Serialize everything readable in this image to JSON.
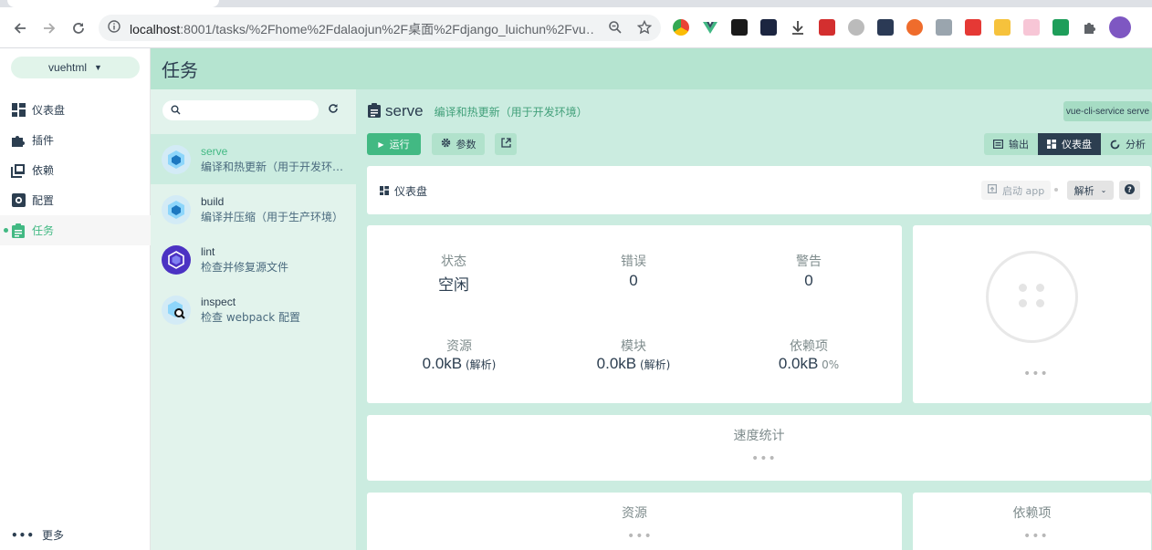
{
  "browser": {
    "url_host": "localhost",
    "url_rest": ":8001/tasks/%2Fhome%2Fdalaojun%2F桌面%2Fdjango_luichun%2Fvu…"
  },
  "project": {
    "name": "vuehtml"
  },
  "nav": {
    "items": [
      {
        "label": "仪表盘",
        "icon": "dashboard-icon"
      },
      {
        "label": "插件",
        "icon": "puzzle-icon"
      },
      {
        "label": "依赖",
        "icon": "library-icon"
      },
      {
        "label": "配置",
        "icon": "settings-icon"
      },
      {
        "label": "任务",
        "icon": "assignment-icon",
        "active": true
      }
    ],
    "more_label": "更多"
  },
  "page": {
    "title": "任务"
  },
  "tasks": [
    {
      "name": "serve",
      "description": "编译和热更新（用于开发环境）",
      "active": true
    },
    {
      "name": "build",
      "description": "编译并压缩（用于生产环境）"
    },
    {
      "name": "lint",
      "description": "检查并修复源文件"
    },
    {
      "name": "inspect",
      "description": "检查 webpack 配置"
    }
  ],
  "task_detail": {
    "name": "serve",
    "description": "编译和热更新（用于开发环境）",
    "command": "vue-cli-service serve",
    "run_label": "运行",
    "params_label": "参数",
    "view_tabs": [
      {
        "label": "输出",
        "icon": "output-icon"
      },
      {
        "label": "仪表盘",
        "icon": "dashboard-icon",
        "active": true
      },
      {
        "label": "分析",
        "icon": "analyze-icon"
      }
    ]
  },
  "dashboard": {
    "title": "仪表盘",
    "start_app_label": "启动 app",
    "mode_select": "解析",
    "help_label": "?",
    "stats": {
      "status_label": "状态",
      "status_value": "空闲",
      "errors_label": "错误",
      "errors_value": "0",
      "warnings_label": "警告",
      "warnings_value": "0",
      "assets_label": "资源",
      "assets_value": "0.0kB",
      "assets_note": "(解析)",
      "modules_label": "模块",
      "modules_value": "0.0kB",
      "modules_note": "(解析)",
      "deps_label": "依赖项",
      "deps_value": "0.0kB",
      "deps_note": "0%"
    },
    "loading_ellipsis": "•••",
    "speed_title": "速度统计",
    "assets_title": "资源",
    "deps_title": "依赖项"
  },
  "colors": {
    "accent": "#42b983",
    "header_bg": "#b5e4d0",
    "dark": "#2c3e50"
  }
}
